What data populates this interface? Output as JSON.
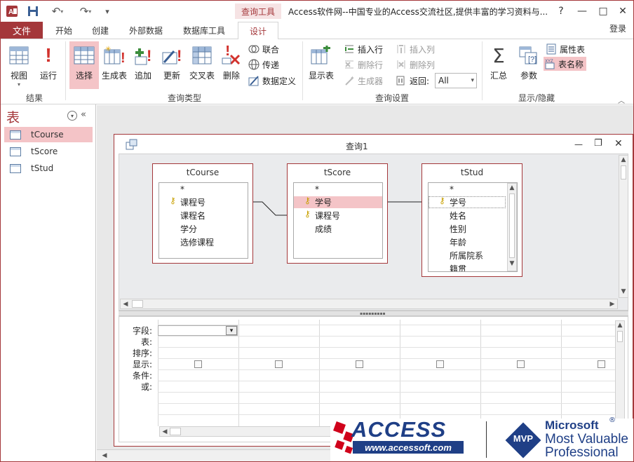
{
  "window": {
    "context_tab": "查询工具",
    "title": "Access软件网--中国专业的Access交流社区,提供丰富的学习资料与...",
    "help": "?",
    "minimize": "—",
    "maximize": "□",
    "close": "✕",
    "login": "登录"
  },
  "tabs": [
    "文件",
    "开始",
    "创建",
    "外部数据",
    "数据库工具",
    "设计"
  ],
  "ribbon": {
    "results": {
      "group": "结果",
      "view": "视图",
      "run": "运行"
    },
    "query_type": {
      "group": "查询类型",
      "select": "选择",
      "make_table": "生成表",
      "append": "追加",
      "update": "更新",
      "crosstab": "交叉表",
      "delete": "删除",
      "union": "联合",
      "pass_through": "传递",
      "data_definition": "数据定义"
    },
    "query_setup": {
      "group": "查询设置",
      "show_table": "显示表",
      "insert_rows": "插入行",
      "delete_rows": "删除行",
      "builder": "生成器",
      "insert_columns": "插入列",
      "delete_columns": "删除列",
      "return_label": "返回:",
      "return_value": "All"
    },
    "show_hide": {
      "group": "显示/隐藏",
      "totals": "汇总",
      "parameters": "参数",
      "property_sheet": "属性表",
      "table_names": "表名称"
    }
  },
  "nav": {
    "header": "表",
    "items": [
      "tCourse",
      "tScore",
      "tStud"
    ]
  },
  "query": {
    "title": "查询1",
    "tables": [
      {
        "name": "tCourse",
        "fields": [
          "*",
          "课程号",
          "课程名",
          "学分",
          "选修课程"
        ]
      },
      {
        "name": "tScore",
        "fields": [
          "*",
          "学号",
          "课程号",
          "成绩"
        ]
      },
      {
        "name": "tStud",
        "fields": [
          "*",
          "学号",
          "姓名",
          "性别",
          "年龄",
          "所属院系",
          "籍贯"
        ]
      }
    ],
    "grid_rows": [
      "字段:",
      "表:",
      "排序:",
      "显示:",
      "条件:",
      "或:"
    ]
  },
  "logo": {
    "access_text": "ACCESS",
    "url": "www.accessoft.com",
    "mvp_badge": "MVP",
    "ms": "Microsoft",
    "mvp_line1": "Most Valuable",
    "mvp_line2": "Professional"
  },
  "colors": {
    "accent": "#a4373a",
    "selected": "#f4c4c7"
  }
}
